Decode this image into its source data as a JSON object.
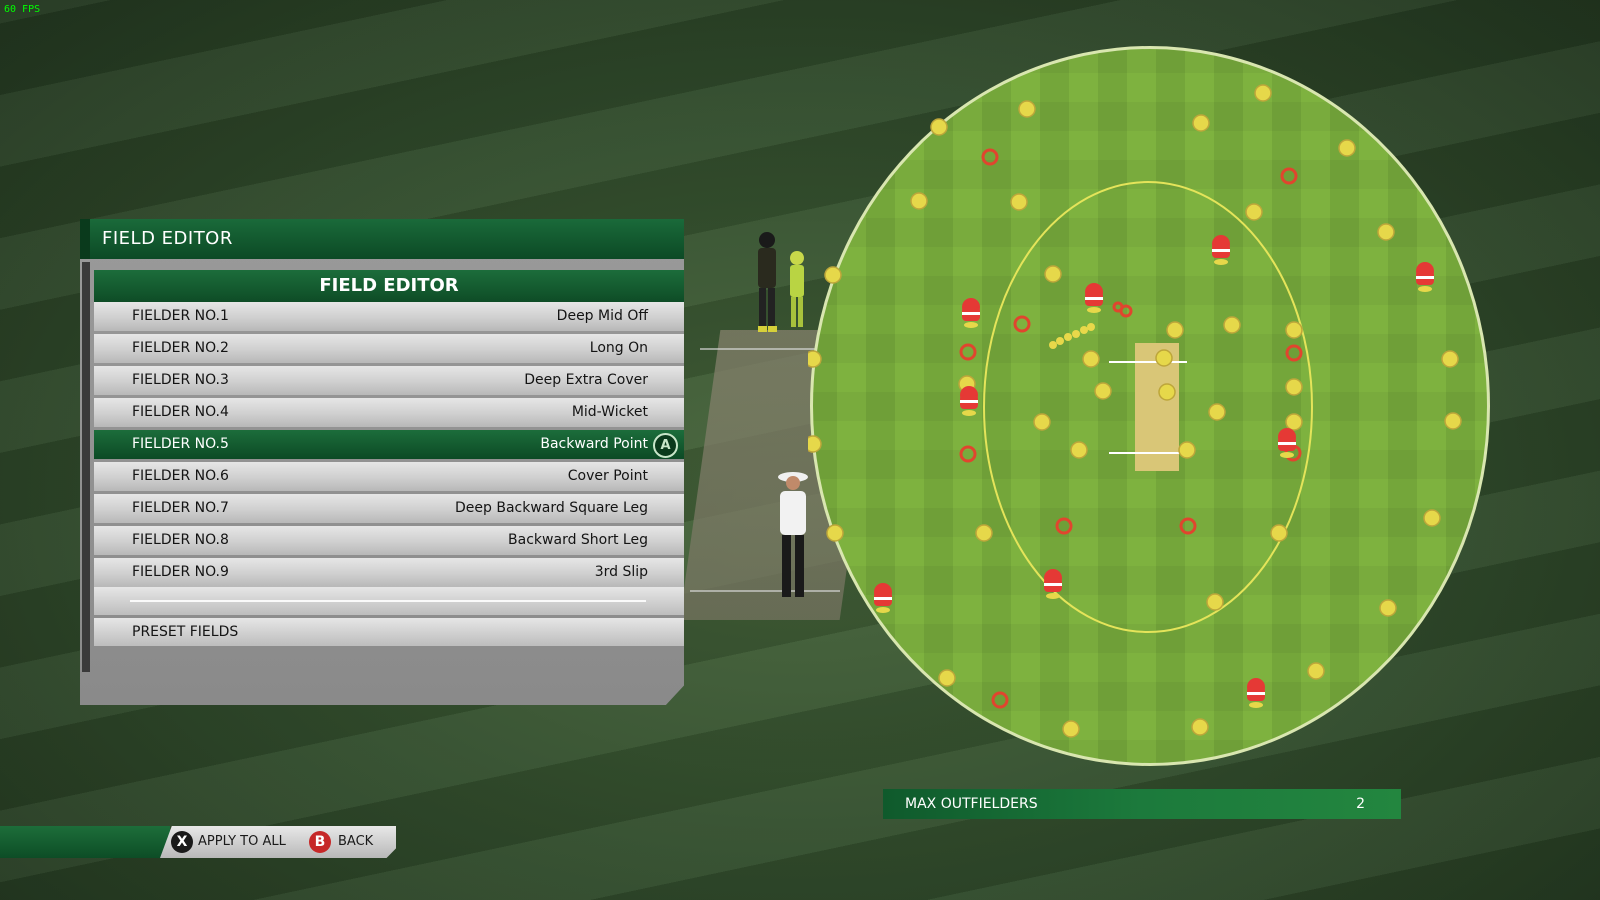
{
  "hud": {
    "fps": "60 FPS"
  },
  "panel": {
    "header_title": "FIELD EDITOR",
    "list_title": "FIELD EDITOR",
    "fielders": [
      {
        "name": "FIELDER NO.1",
        "position": "Deep Mid Off"
      },
      {
        "name": "FIELDER NO.2",
        "position": "Long On"
      },
      {
        "name": "FIELDER NO.3",
        "position": "Deep Extra Cover"
      },
      {
        "name": "FIELDER NO.4",
        "position": "Mid-Wicket"
      },
      {
        "name": "FIELDER NO.5",
        "position": "Backward Point"
      },
      {
        "name": "FIELDER NO.6",
        "position": "Cover Point"
      },
      {
        "name": "FIELDER NO.7",
        "position": "Deep Backward Square Leg"
      },
      {
        "name": "FIELDER NO.8",
        "position": "Backward Short Leg"
      },
      {
        "name": "FIELDER NO.9",
        "position": "3rd Slip"
      }
    ],
    "selected_index": 4,
    "selected_button": "A",
    "preset_label": "PRESET FIELDS"
  },
  "controls": {
    "apply_icon": "X",
    "apply_label": "APPLY TO ALL",
    "back_icon": "B",
    "back_label": "BACK"
  },
  "max_outfielders": {
    "label": "MAX OUTFIELDERS",
    "value": "2"
  },
  "colors": {
    "accent_green": "#0e4c26",
    "field_grass": "#7fb23e",
    "marker_yellow": "#e8d84a",
    "marker_red": "#e0452e"
  }
}
